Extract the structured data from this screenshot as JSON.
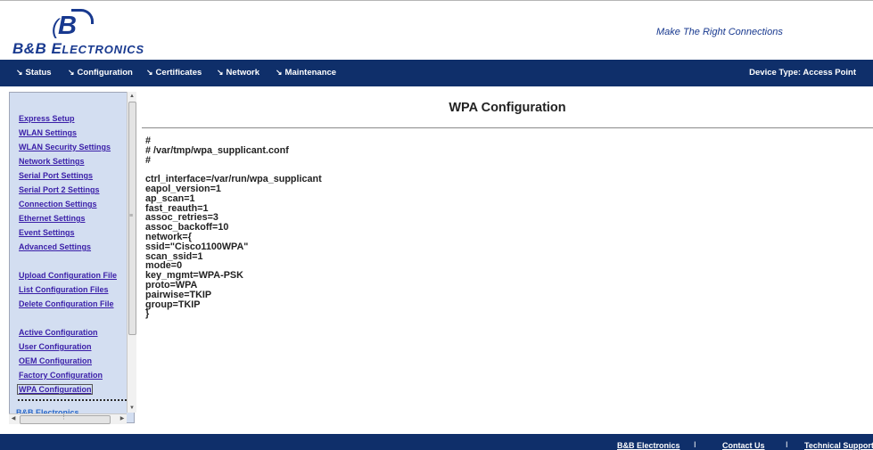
{
  "brand": {
    "mark": "B",
    "name_prefix": "B&B E",
    "name_rest": "LECTRONICS",
    "tagline": "Make The Right Connections"
  },
  "nav": {
    "items": [
      {
        "label": "Status"
      },
      {
        "label": "Configuration"
      },
      {
        "label": "Certificates"
      },
      {
        "label": "Network"
      },
      {
        "label": "Maintenance"
      }
    ],
    "arrow_glyph": "↘",
    "device_type": "Device Type: Access Point"
  },
  "sidebar": {
    "groups": [
      [
        "Express Setup",
        "WLAN Settings",
        "WLAN Security Settings",
        "Network Settings",
        "Serial Port Settings",
        "Serial Port 2 Settings",
        "Connection Settings",
        "Ethernet Settings",
        "Event Settings",
        "Advanced Settings"
      ],
      [
        "Upload Configuration File",
        "List Configuration Files",
        "Delete Configuration File"
      ],
      [
        "Active Configuration",
        "User Configuration",
        "OEM Configuration",
        "Factory Configuration",
        "WPA Configuration"
      ]
    ],
    "active": "WPA Configuration",
    "footer_link": "B&B Electronics"
  },
  "main": {
    "title": "WPA Configuration",
    "config_lines": [
      "#",
      "# /var/tmp/wpa_supplicant.conf",
      "#",
      "",
      "ctrl_interface=/var/run/wpa_supplicant",
      "eapol_version=1",
      "ap_scan=1",
      "fast_reauth=1",
      "assoc_retries=3",
      "assoc_backoff=10",
      "network={",
      "ssid=\"Cisco1100WPA\"",
      "scan_ssid=1",
      "mode=0",
      "key_mgmt=WPA-PSK",
      "proto=WPA",
      "pairwise=TKIP",
      "group=TKIP",
      "}"
    ]
  },
  "footer": {
    "links": [
      "B&B Electronics",
      "Contact Us",
      "Technical Support"
    ],
    "separator": "I"
  },
  "colors": {
    "navbar": "#0f2f6a",
    "brand_blue": "#18398f",
    "sidebar_bg": "#d3def1",
    "link": "#3a1ea8"
  }
}
